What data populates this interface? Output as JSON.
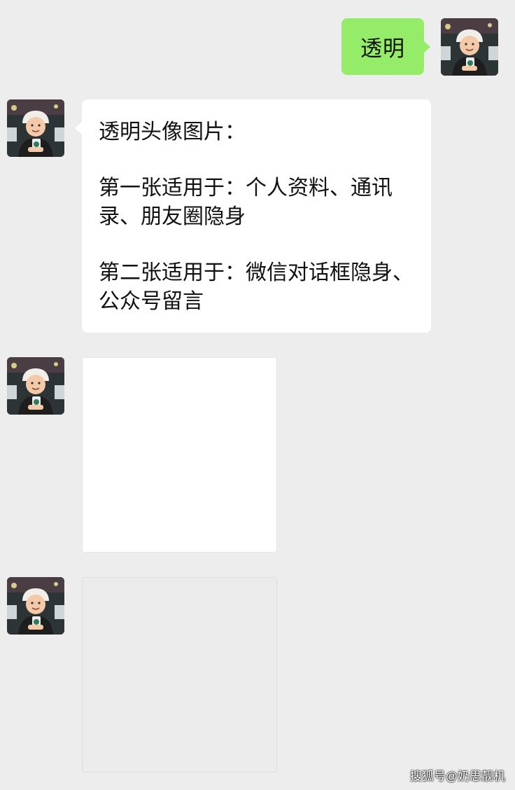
{
  "messages": [
    {
      "type": "text",
      "side": "right",
      "text": "透明"
    },
    {
      "type": "text",
      "side": "left",
      "paragraphs": [
        "透明头像图片：",
        "第一张适用于：个人资料、通讯录、朋友圈隐身",
        "第二张适用于：微信对话框隐身、公众号留言"
      ]
    },
    {
      "type": "image",
      "side": "left"
    },
    {
      "type": "image",
      "side": "left"
    }
  ],
  "watermark": "搜狐号@奶思靓机",
  "colors": {
    "background": "#ededed",
    "bubble_self": "#95ec69",
    "bubble_other": "#ffffff"
  },
  "icons": [
    "avatar-photo"
  ]
}
